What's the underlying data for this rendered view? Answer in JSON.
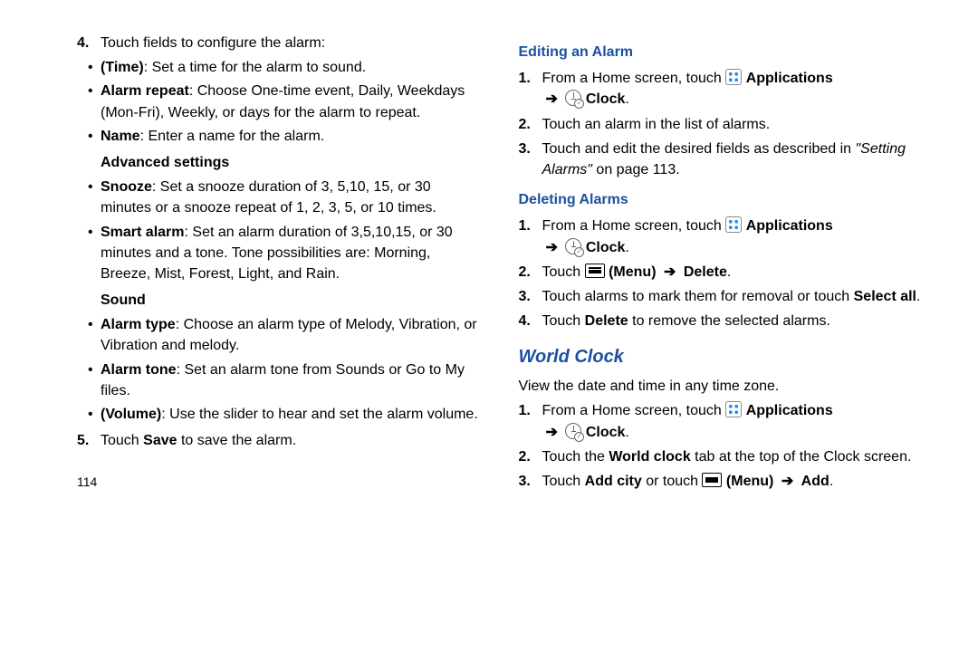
{
  "left": {
    "step4_num": "4.",
    "step4_intro": "Touch fields to configure the alarm:",
    "step4_bullets": [
      {
        "b": "(Time)",
        "t": ": Set a time for the alarm to sound."
      },
      {
        "b": "Alarm repeat",
        "t": ": Choose One-time event, Daily, Weekdays (Mon-Fri), Weekly, or days for the alarm to repeat."
      },
      {
        "b": "Name",
        "t": ": Enter a name for the alarm."
      }
    ],
    "adv_head": "Advanced settings",
    "adv_bullets": [
      {
        "b": "Snooze",
        "t": ": Set a snooze duration of 3, 5,10, 15, or 30 minutes or a snooze repeat of 1, 2, 3, 5, or 10 times."
      },
      {
        "b": "Smart alarm",
        "t": ": Set an alarm duration of 3,5,10,15, or 30 minutes and a tone. Tone possibilities are: Morning, Breeze, Mist, Forest, Light, and Rain."
      }
    ],
    "sound_head": "Sound",
    "sound_bullets": [
      {
        "b": "Alarm type",
        "t": ": Choose an alarm type of Melody, Vibration, or Vibration and melody."
      },
      {
        "b": "Alarm tone",
        "t": ": Set an alarm tone from Sounds or Go to My files."
      },
      {
        "b": "(Volume)",
        "t": ": Use the slider to hear and set the alarm volume."
      }
    ],
    "step5_num": "5.",
    "step5_a": "Touch ",
    "step5_b": "Save",
    "step5_c": " to save the alarm.",
    "pagenum": "114"
  },
  "right": {
    "edit_head": "Editing an Alarm",
    "from_home": "From a Home screen, touch ",
    "apps_label": "Applications",
    "arrow": "➔",
    "clock_label": "Clock",
    "edit_s2": "Touch an alarm in the list of alarms.",
    "edit_s3a": "Touch and edit the desired fields as described in ",
    "edit_s3_ref": "\"Setting Alarms\"",
    "edit_s3b": " on page 113.",
    "del_head": "Deleting Alarms",
    "del_s2a": "Touch ",
    "menu_label": "(Menu)",
    "del_s2b": "Delete",
    "del_s3a": "Touch alarms to mark them for removal or touch ",
    "del_s3b": "Select all",
    "del_s4a": "Touch ",
    "del_s4b": "Delete",
    "del_s4c": " to remove the selected alarms.",
    "wc_head": "World Clock",
    "wc_intro": "View the date and time in any time zone.",
    "wc_s2a": "Touch the ",
    "wc_s2b": "World clock",
    "wc_s2c": " tab at the top of the Clock screen.",
    "wc_s3a": "Touch ",
    "wc_s3b": "Add city",
    "wc_s3c": " or touch ",
    "wc_s3d": "Add",
    "n1": "1.",
    "n2": "2.",
    "n3": "3.",
    "n4": "4."
  }
}
